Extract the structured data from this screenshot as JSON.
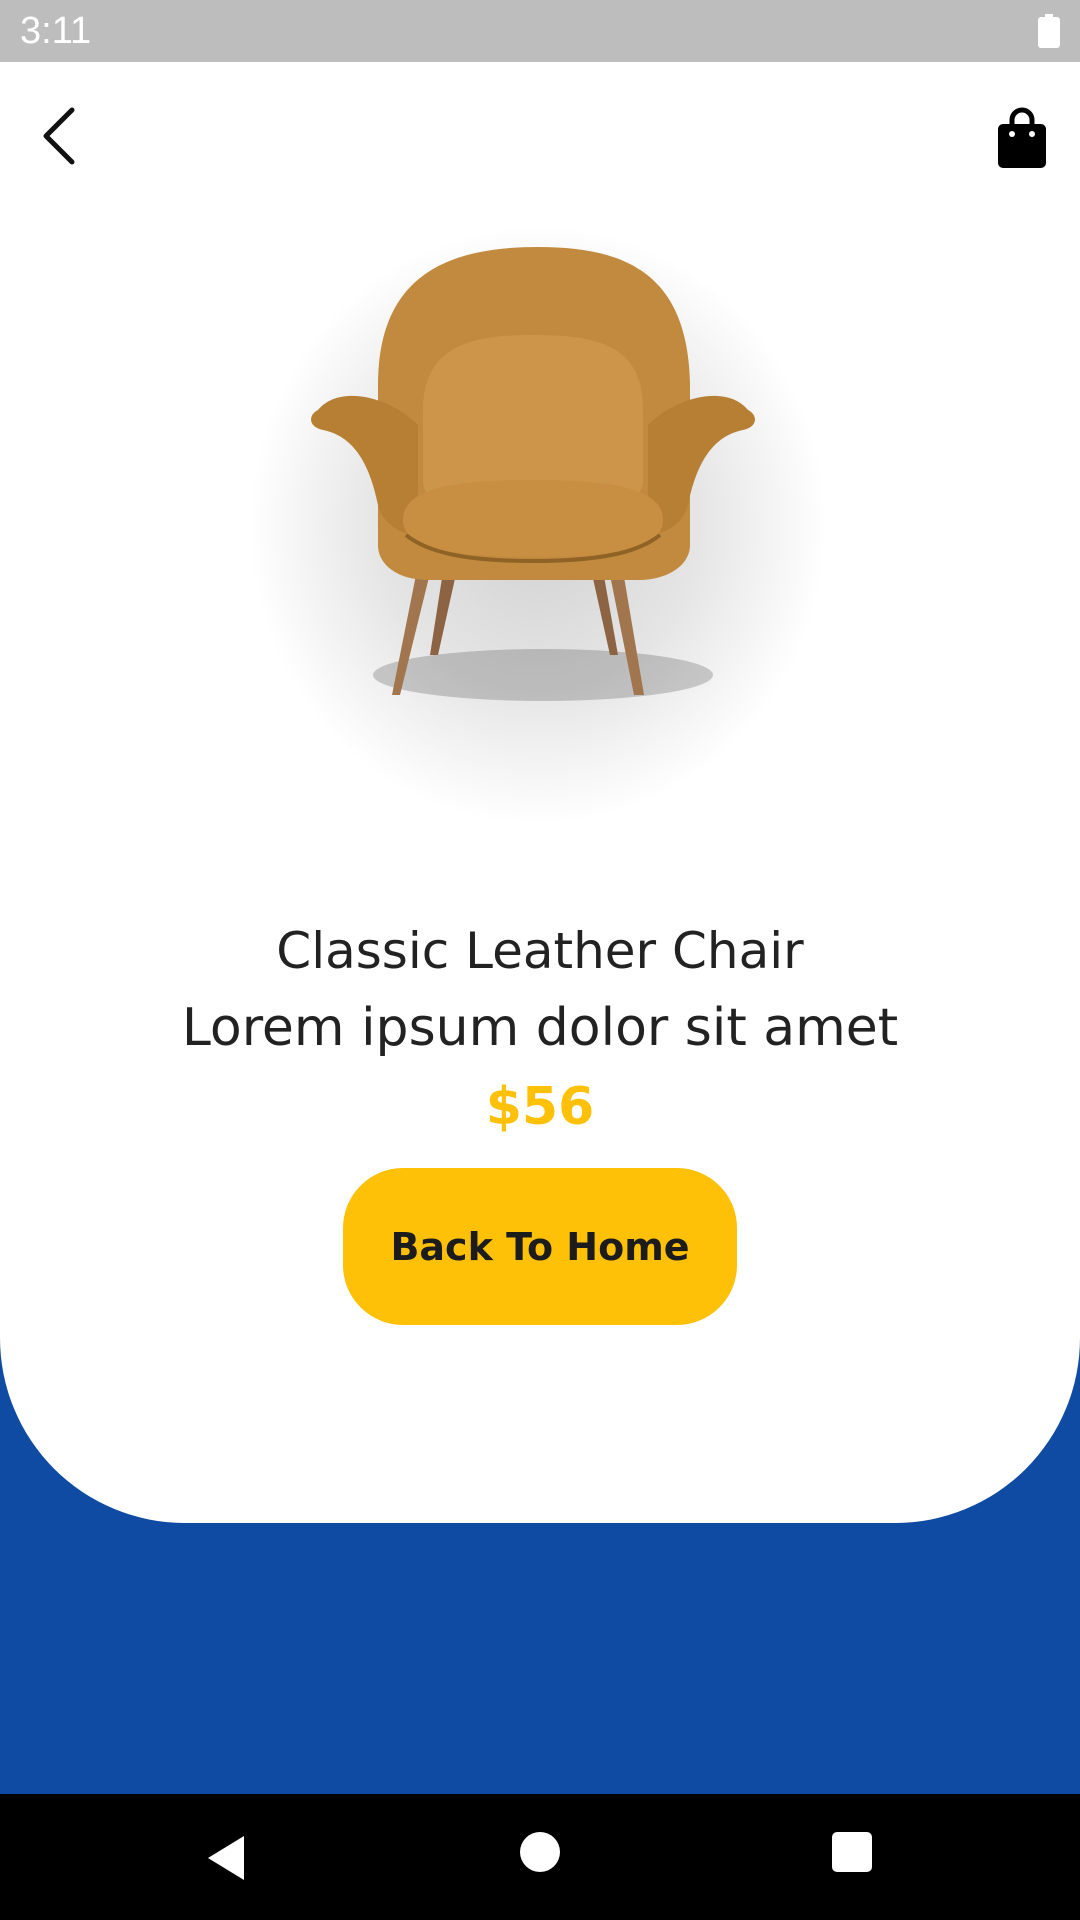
{
  "status_bar": {
    "time": "3:11",
    "battery_icon": "battery-full-icon"
  },
  "header": {
    "back_icon": "chevron-left-icon",
    "cart_icon": "shopping-bag-icon"
  },
  "product": {
    "image_icon": "armchair-image",
    "name": "Classic Leather Chair",
    "description": "Lorem ipsum dolor sit amet",
    "price": "$56"
  },
  "actions": {
    "home_label": "Back To Home"
  },
  "colors": {
    "accent": "#ffc107",
    "background": "#0f4aa3",
    "card": "#ffffff"
  },
  "nav_bar": {
    "back_icon": "nav-back-icon",
    "home_icon": "nav-home-icon",
    "recents_icon": "nav-recents-icon"
  }
}
